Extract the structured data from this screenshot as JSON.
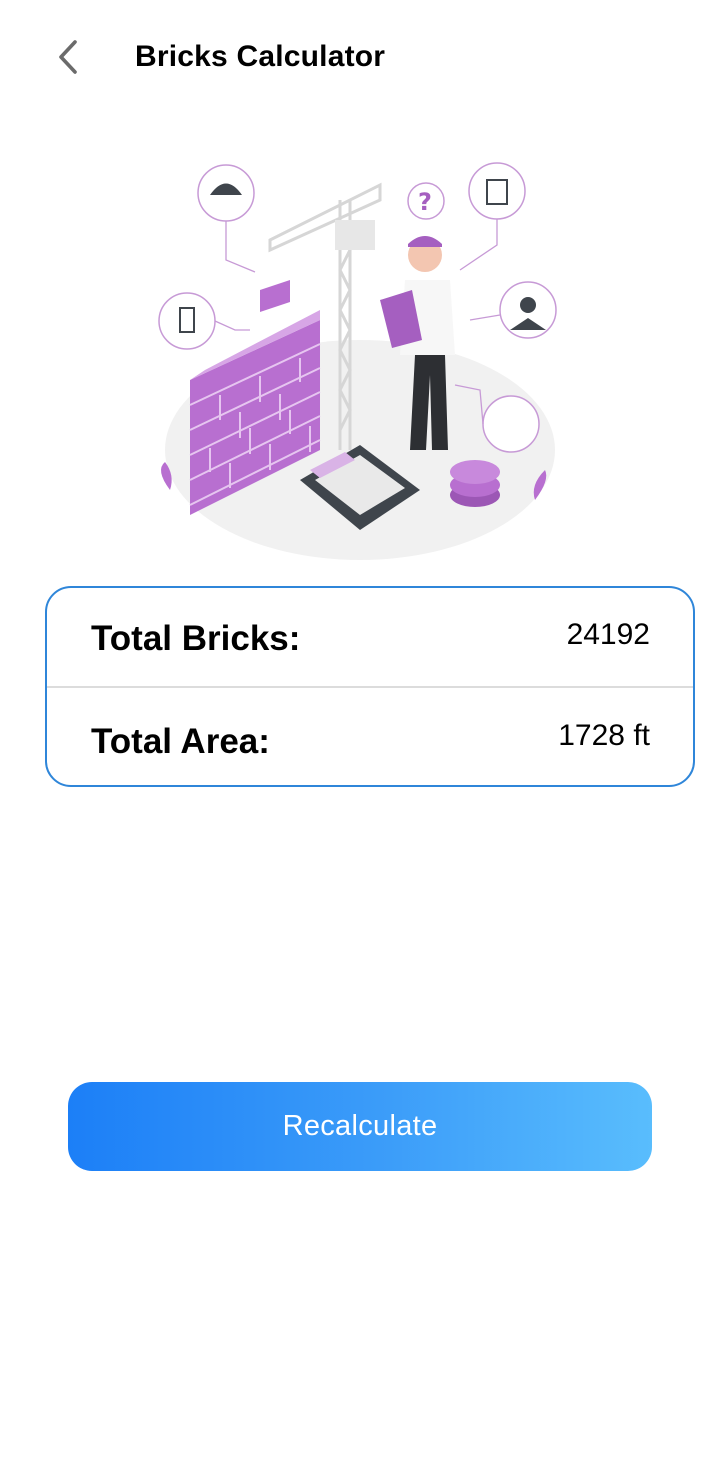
{
  "header": {
    "title": "Bricks Calculator"
  },
  "illustration": {
    "name": "bricks-construction-illustration",
    "accent_color": "#b06fc7"
  },
  "results": {
    "rows": [
      {
        "label": "Total Bricks:",
        "value": "24192"
      },
      {
        "label": "Total Area:",
        "value": "1728 ft"
      }
    ],
    "border_color": "#2f86d9"
  },
  "actions": {
    "recalculate_label": "Recalculate",
    "button_gradient": [
      "#1c7ff7",
      "#59bdfd"
    ]
  }
}
